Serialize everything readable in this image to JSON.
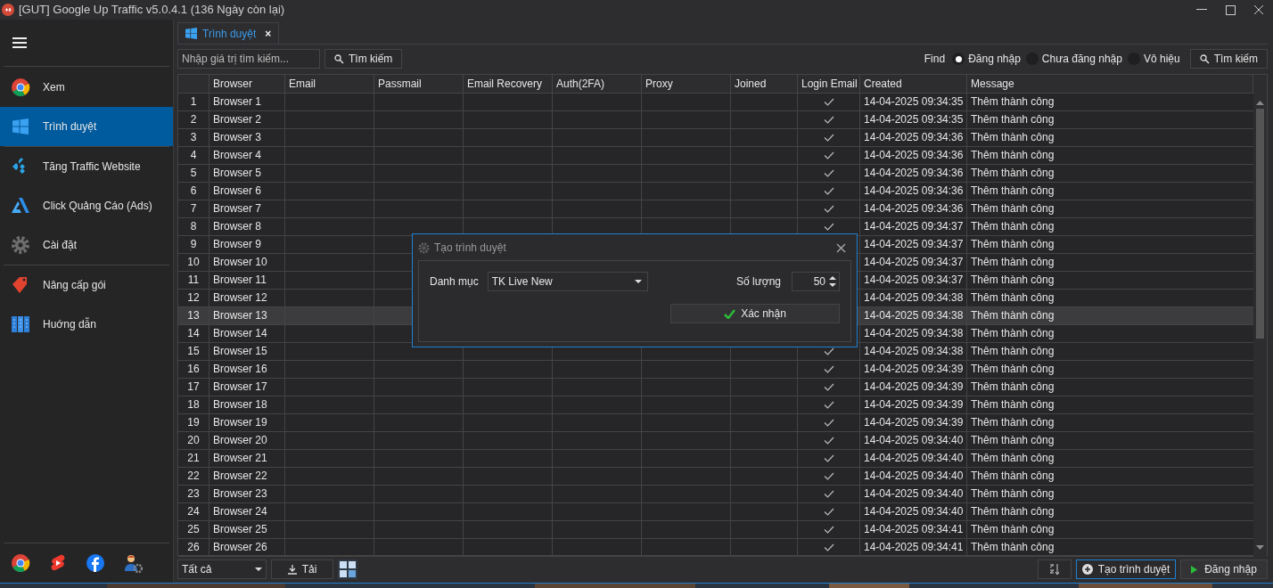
{
  "window": {
    "title": "[GUT] Google Up Traffic v5.0.4.1 (136 Ngày còn lại)"
  },
  "sidebar": {
    "items": [
      {
        "label": "Xem",
        "selected": false
      },
      {
        "label": "Trình duyệt",
        "selected": true
      },
      {
        "label": "Tăng Traffic Website",
        "selected": false
      },
      {
        "label": "Click Quảng Cáo (Ads)",
        "selected": false
      },
      {
        "label": "Cài đặt",
        "selected": false
      },
      {
        "label": "Nâng cấp gói",
        "selected": false
      },
      {
        "label": "Huớng dẫn",
        "selected": false
      }
    ]
  },
  "tabs": [
    {
      "label": "Trình duyệt",
      "selected": true,
      "close": "×"
    }
  ],
  "toolbar": {
    "search_placeholder": "Nhập giá trị tìm kiếm...",
    "search_button": "Tìm kiếm",
    "find_label": "Find",
    "filters": [
      {
        "label": "Đăng nhập",
        "selected": true
      },
      {
        "label": "Chưa đăng nhập",
        "selected": false
      },
      {
        "label": "Vô hiệu",
        "selected": false
      }
    ],
    "find_button": "Tìm kiếm"
  },
  "table": {
    "columns": [
      "Browser",
      "Email",
      "Passmail",
      "Email Recovery",
      "Auth(2FA)",
      "Proxy",
      "Joined",
      "Login Email",
      "Created",
      "Message"
    ],
    "rows": [
      {
        "no": "1",
        "browser": "Browser 1",
        "login_email": true,
        "created": "14-04-2025 09:34:35",
        "message": "Thêm thành công",
        "selected": false
      },
      {
        "no": "2",
        "browser": "Browser 2",
        "login_email": true,
        "created": "14-04-2025 09:34:35",
        "message": "Thêm thành công",
        "selected": false
      },
      {
        "no": "3",
        "browser": "Browser 3",
        "login_email": true,
        "created": "14-04-2025 09:34:36",
        "message": "Thêm thành công",
        "selected": false
      },
      {
        "no": "4",
        "browser": "Browser 4",
        "login_email": true,
        "created": "14-04-2025 09:34:36",
        "message": "Thêm thành công",
        "selected": false
      },
      {
        "no": "5",
        "browser": "Browser 5",
        "login_email": true,
        "created": "14-04-2025 09:34:36",
        "message": "Thêm thành công",
        "selected": false
      },
      {
        "no": "6",
        "browser": "Browser 6",
        "login_email": true,
        "created": "14-04-2025 09:34:36",
        "message": "Thêm thành công",
        "selected": false
      },
      {
        "no": "7",
        "browser": "Browser 7",
        "login_email": true,
        "created": "14-04-2025 09:34:36",
        "message": "Thêm thành công",
        "selected": false
      },
      {
        "no": "8",
        "browser": "Browser 8",
        "login_email": true,
        "created": "14-04-2025 09:34:37",
        "message": "Thêm thành công",
        "selected": false
      },
      {
        "no": "9",
        "browser": "Browser 9",
        "created": "14-04-2025 09:34:37",
        "message": "Thêm thành công",
        "selected": false
      },
      {
        "no": "10",
        "browser": "Browser 10",
        "created": "14-04-2025 09:34:37",
        "message": "Thêm thành công",
        "selected": false
      },
      {
        "no": "11",
        "browser": "Browser 11",
        "created": "14-04-2025 09:34:37",
        "message": "Thêm thành công",
        "selected": false
      },
      {
        "no": "12",
        "browser": "Browser 12",
        "created": "14-04-2025 09:34:38",
        "message": "Thêm thành công",
        "selected": false
      },
      {
        "no": "13",
        "browser": "Browser 13",
        "created": "14-04-2025 09:34:38",
        "message": "Thêm thành công",
        "selected": true
      },
      {
        "no": "14",
        "browser": "Browser 14",
        "created": "14-04-2025 09:34:38",
        "message": "Thêm thành công",
        "selected": false
      },
      {
        "no": "15",
        "browser": "Browser 15",
        "login_email": true,
        "created": "14-04-2025 09:34:38",
        "message": "Thêm thành công",
        "selected": false
      },
      {
        "no": "16",
        "browser": "Browser 16",
        "login_email": true,
        "created": "14-04-2025 09:34:39",
        "message": "Thêm thành công",
        "selected": false
      },
      {
        "no": "17",
        "browser": "Browser 17",
        "login_email": true,
        "created": "14-04-2025 09:34:39",
        "message": "Thêm thành công",
        "selected": false
      },
      {
        "no": "18",
        "browser": "Browser 18",
        "login_email": true,
        "created": "14-04-2025 09:34:39",
        "message": "Thêm thành công",
        "selected": false
      },
      {
        "no": "19",
        "browser": "Browser 19",
        "login_email": true,
        "created": "14-04-2025 09:34:39",
        "message": "Thêm thành công",
        "selected": false
      },
      {
        "no": "20",
        "browser": "Browser 20",
        "login_email": true,
        "created": "14-04-2025 09:34:40",
        "message": "Thêm thành công",
        "selected": false
      },
      {
        "no": "21",
        "browser": "Browser 21",
        "login_email": true,
        "created": "14-04-2025 09:34:40",
        "message": "Thêm thành công",
        "selected": false
      },
      {
        "no": "22",
        "browser": "Browser 22",
        "login_email": true,
        "created": "14-04-2025 09:34:40",
        "message": "Thêm thành công",
        "selected": false
      },
      {
        "no": "23",
        "browser": "Browser 23",
        "login_email": true,
        "created": "14-04-2025 09:34:40",
        "message": "Thêm thành công",
        "selected": false
      },
      {
        "no": "24",
        "browser": "Browser 24",
        "login_email": true,
        "created": "14-04-2025 09:34:40",
        "message": "Thêm thành công",
        "selected": false
      },
      {
        "no": "25",
        "browser": "Browser 25",
        "login_email": true,
        "created": "14-04-2025 09:34:41",
        "message": "Thêm thành công",
        "selected": false
      },
      {
        "no": "26",
        "browser": "Browser 26",
        "login_email": true,
        "created": "14-04-2025 09:34:41",
        "message": "Thêm thành công",
        "selected": false
      }
    ]
  },
  "bottom_bar": {
    "filter_value": "Tất cả",
    "download_button": "Tải",
    "create_button": "Tạo trình duyệt",
    "login_button": "Đăng nhập"
  },
  "dialog": {
    "title": "Tạo trình duyệt",
    "category_label": "Danh mục",
    "category_value": "TK Live New",
    "quantity_label": "Số lượng",
    "quantity_value": "50",
    "confirm_button": "Xác nhận"
  }
}
